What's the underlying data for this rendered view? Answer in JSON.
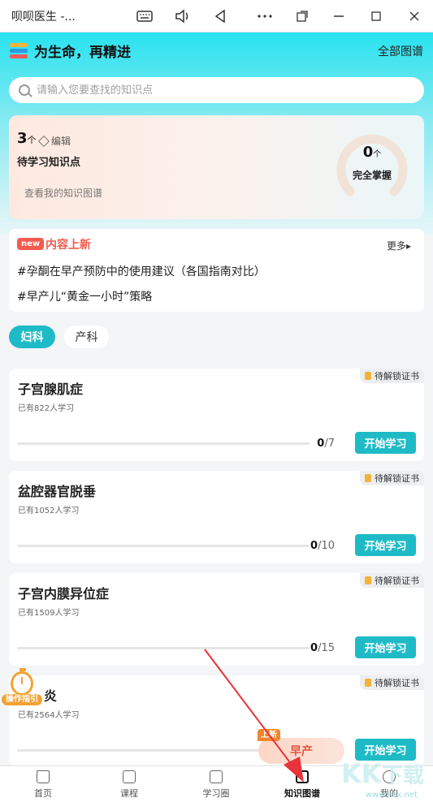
{
  "window": {
    "title": "呗呗医生 -...",
    "buttons": [
      "keyboard-icon",
      "volume-icon",
      "back-icon",
      "more-icon",
      "screen-rotate-icon",
      "minimize-icon",
      "maximize-icon",
      "close-icon"
    ]
  },
  "header": {
    "title": "为生命，再精进",
    "all_link": "全部图谱",
    "search_placeholder": "请输入您要查找的知识点"
  },
  "progress_card": {
    "pending_count": "3",
    "count_unit": "个",
    "edit_label": "编辑",
    "pending_label": "待学习知识点",
    "view_link": "查看我的知识图谱",
    "mastered_count": "0",
    "mastered_unit": "个",
    "mastered_label": "完全掌握"
  },
  "news": {
    "badge": "new",
    "title": "内容上新",
    "more": "更多▸",
    "items": [
      "#孕酮在早产预防中的使用建议（各国指南对比）",
      "#早产儿“黄金一小时”策略"
    ]
  },
  "tabs": [
    {
      "label": "妇科",
      "active": true
    },
    {
      "label": "产科",
      "active": false
    }
  ],
  "courses": [
    {
      "name": "子宫腺肌症",
      "learners": "已有822人学习",
      "done": "0",
      "total": "/7",
      "cert": "待解锁证书",
      "button": "开始学习"
    },
    {
      "name": "盆腔器官脱垂",
      "learners": "已有1052人学习",
      "done": "0",
      "total": "/10",
      "cert": "待解锁证书",
      "button": "开始学习"
    },
    {
      "name": "子宫内膜异位症",
      "learners": "已有1509人学习",
      "done": "0",
      "total": "/15",
      "cert": "待解锁证书",
      "button": "开始学习"
    },
    {
      "name": "炎",
      "learners": "已有2564人学习",
      "done": "",
      "total": "",
      "cert": "待解锁证书",
      "button": "开始学习"
    }
  ],
  "guide": {
    "label": "操作指引"
  },
  "floating": {
    "badge": "上新",
    "pill": "早产"
  },
  "nav": [
    {
      "label": "首页",
      "icon": "home-icon"
    },
    {
      "label": "课程",
      "icon": "course-icon"
    },
    {
      "label": "学习圈",
      "icon": "study-circle-icon"
    },
    {
      "label": "知识图谱",
      "icon": "knowledge-map-icon",
      "active": true
    },
    {
      "label": "我的",
      "icon": "profile-icon"
    }
  ],
  "watermark": {
    "text": "KK下载",
    "url": "www.kkx.net"
  },
  "colors": {
    "accent": "#1ebbc7",
    "new_red": "#f35a4d",
    "cert_gold": "#f3b23a",
    "arrow_red": "#e8333c"
  }
}
